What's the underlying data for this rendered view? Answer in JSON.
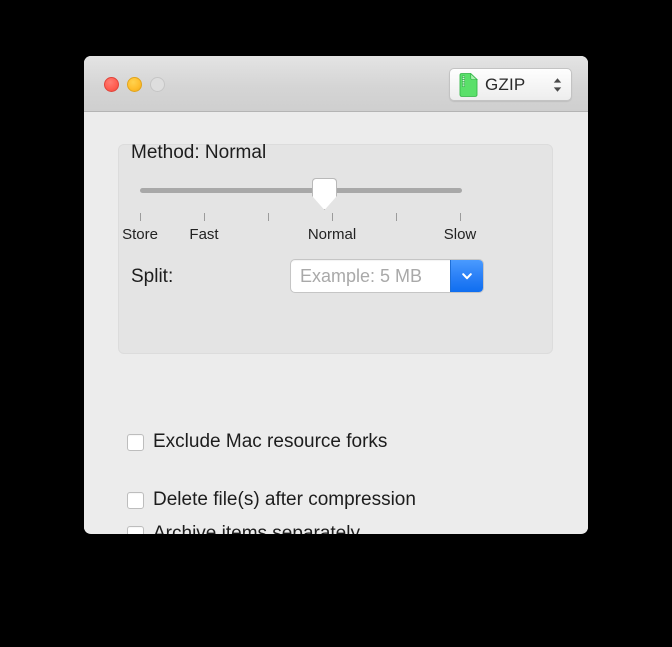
{
  "window": {
    "traffic_lights": [
      {
        "name": "close",
        "color": "#ff5f52",
        "state": "enabled"
      },
      {
        "name": "minimize",
        "color": "#ffbe2e",
        "state": "enabled"
      },
      {
        "name": "zoom",
        "color": "#dedede",
        "state": "disabled"
      }
    ],
    "format_popup": {
      "label": "GZIP",
      "icon": "gzip-file-icon",
      "icon_color": "#4cd964",
      "stepper_icon": "up-down-chevron-icon"
    }
  },
  "method_group": {
    "title": "Method: Normal",
    "slider": {
      "selected": "Normal",
      "value_index": 3,
      "tick_count": 6,
      "labels": [
        {
          "text": "Store",
          "tick": 0
        },
        {
          "text": "Fast",
          "tick": 1
        },
        {
          "text": "Normal",
          "tick": 3
        },
        {
          "text": "Slow",
          "tick": 5
        }
      ]
    },
    "split": {
      "label": "Split:",
      "value": "",
      "placeholder": "Example: 5 MB",
      "dropdown_icon": "chevron-down-icon",
      "dropdown_color": "#2d82f7"
    }
  },
  "options": [
    {
      "label": "Exclude Mac resource forks",
      "checked": false
    },
    {
      "label": "Delete file(s) after compression",
      "checked": false
    },
    {
      "label": "Archive items separately",
      "checked": false
    }
  ]
}
